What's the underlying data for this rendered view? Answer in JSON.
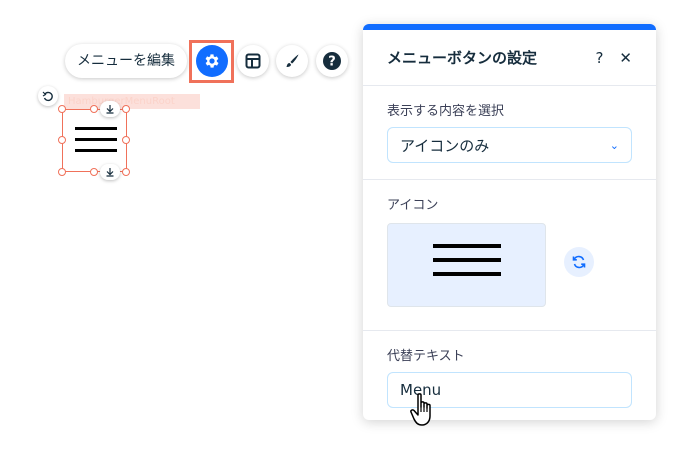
{
  "toolbar": {
    "edit_menu_label": "メニューを編集",
    "settings_icon": "gear-icon",
    "layout_icon": "layout-icon",
    "design_icon": "brush-icon",
    "help_icon": "help-icon",
    "highlight_color": "#f0715a"
  },
  "canvas": {
    "element_tag": "HamburgerMenuRoot",
    "hamburger_icon": "hamburger-menu-icon"
  },
  "panel": {
    "title": "メニューボタンの設定",
    "help_label": "?",
    "close_label": "✕",
    "display_section": {
      "label": "表示する内容を選択",
      "selected_option": "アイコンのみ"
    },
    "icon_section": {
      "label": "アイコン",
      "icon": "hamburger-menu-icon",
      "replace_icon": "refresh-icon"
    },
    "alt_text_section": {
      "label": "代替テキスト",
      "value": "Menu"
    }
  },
  "colors": {
    "accent": "#116dff",
    "preview_bg": "#e7f0ff",
    "selection": "#f0715a"
  }
}
